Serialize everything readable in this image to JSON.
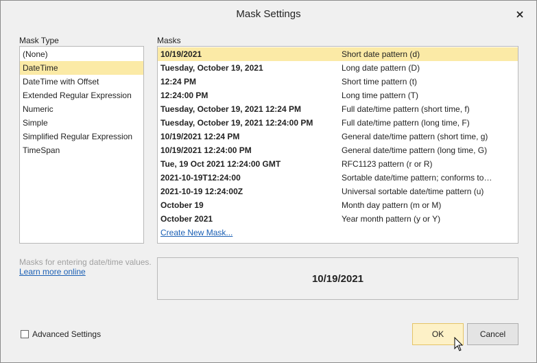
{
  "window": {
    "title": "Mask Settings"
  },
  "mask_type": {
    "label": "Mask Type",
    "selected_index": 1,
    "items": [
      "(None)",
      "DateTime",
      "DateTime with Offset",
      "Extended Regular Expression",
      "Numeric",
      "Simple",
      "Simplified Regular Expression",
      "TimeSpan"
    ]
  },
  "masks": {
    "label": "Masks",
    "selected_index": 0,
    "rows": [
      {
        "example": "10/19/2021",
        "description": "Short date pattern (d)"
      },
      {
        "example": "Tuesday, October 19, 2021",
        "description": "Long date pattern (D)"
      },
      {
        "example": "12:24 PM",
        "description": "Short time pattern (t)"
      },
      {
        "example": "12:24:00 PM",
        "description": "Long time pattern (T)"
      },
      {
        "example": "Tuesday, October 19, 2021 12:24 PM",
        "description": "Full date/time pattern (short time, f)"
      },
      {
        "example": "Tuesday, October 19, 2021 12:24:00 PM",
        "description": "Full date/time pattern (long time, F)"
      },
      {
        "example": "10/19/2021 12:24 PM",
        "description": "General date/time pattern (short time, g)"
      },
      {
        "example": "10/19/2021 12:24:00 PM",
        "description": "General date/time pattern (long time, G)"
      },
      {
        "example": "Tue, 19 Oct 2021 12:24:00 GMT",
        "description": "RFC1123 pattern (r or R)"
      },
      {
        "example": "2021-10-19T12:24:00",
        "description": "Sortable date/time pattern; conforms to ..."
      },
      {
        "example": "2021-10-19 12:24:00Z",
        "description": "Universal sortable date/time pattern (u)"
      },
      {
        "example": "October 19",
        "description": "Month day pattern (m or M)"
      },
      {
        "example": "October 2021",
        "description": "Year month pattern (y or Y)"
      }
    ],
    "create_link": "Create New Mask..."
  },
  "hint": {
    "text": "Masks for entering date/time values.",
    "link": "Learn more online"
  },
  "preview": {
    "value": "10/19/2021"
  },
  "advanced": {
    "label": "Advanced Settings",
    "checked": false
  },
  "buttons": {
    "ok": "OK",
    "cancel": "Cancel"
  },
  "colors": {
    "selection": "#fbeaa6",
    "link": "#1a5fb4",
    "ok_button": "#fdf1c7"
  }
}
